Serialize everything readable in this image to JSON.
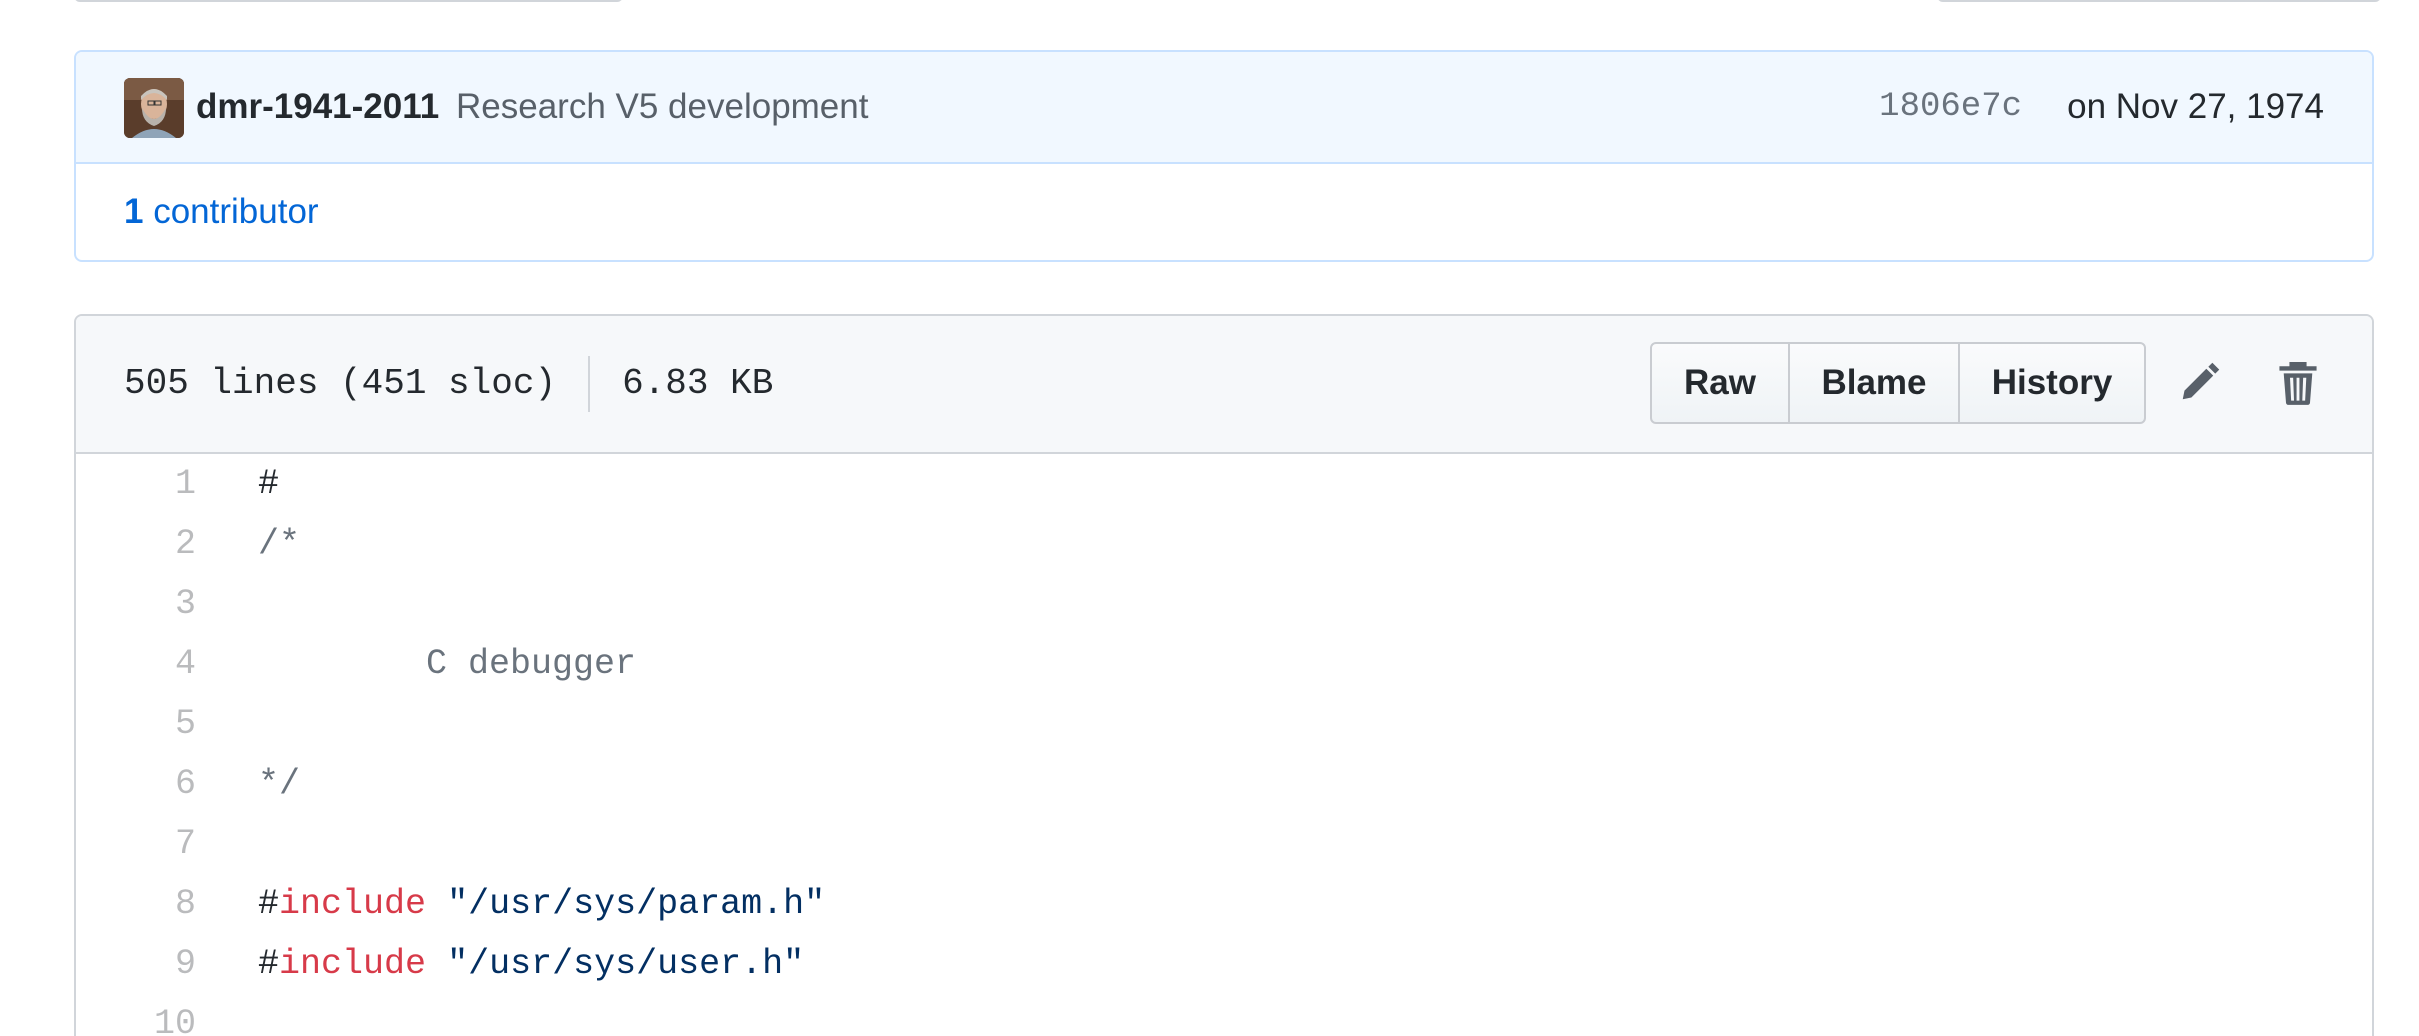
{
  "commit": {
    "author": "dmr-1941-2011",
    "message": "Research V5 development",
    "sha": "1806e7c",
    "date": "on Nov 27, 1974",
    "contributors_count": "1",
    "contributors_label": "contributor"
  },
  "file": {
    "lines_info": "505 lines (451 sloc)",
    "size": "6.83 KB",
    "buttons": {
      "raw": "Raw",
      "blame": "Blame",
      "history": "History"
    },
    "icons": {
      "edit": "pencil-icon",
      "delete": "trash-icon"
    }
  },
  "code_lines": [
    {
      "num": "1",
      "text": "#"
    },
    {
      "num": "2",
      "text": "/*"
    },
    {
      "num": "3",
      "text": ""
    },
    {
      "num": "4",
      "text": "        C debugger"
    },
    {
      "num": "5",
      "text": ""
    },
    {
      "num": "6",
      "text": "*/"
    },
    {
      "num": "7",
      "text": ""
    },
    {
      "num": "8",
      "hash": "#",
      "keyword": "include",
      "string": "\"/usr/sys/param.h\""
    },
    {
      "num": "9",
      "hash": "#",
      "keyword": "include",
      "string": "\"/usr/sys/user.h\""
    },
    {
      "num": "10",
      "text": ""
    }
  ],
  "colors": {
    "commit_bg": "#f1f8ff",
    "link": "#0366d6",
    "keyword": "#d73a49",
    "string": "#032f62",
    "comment": "#6a737d",
    "line_number": "#babbbd"
  }
}
